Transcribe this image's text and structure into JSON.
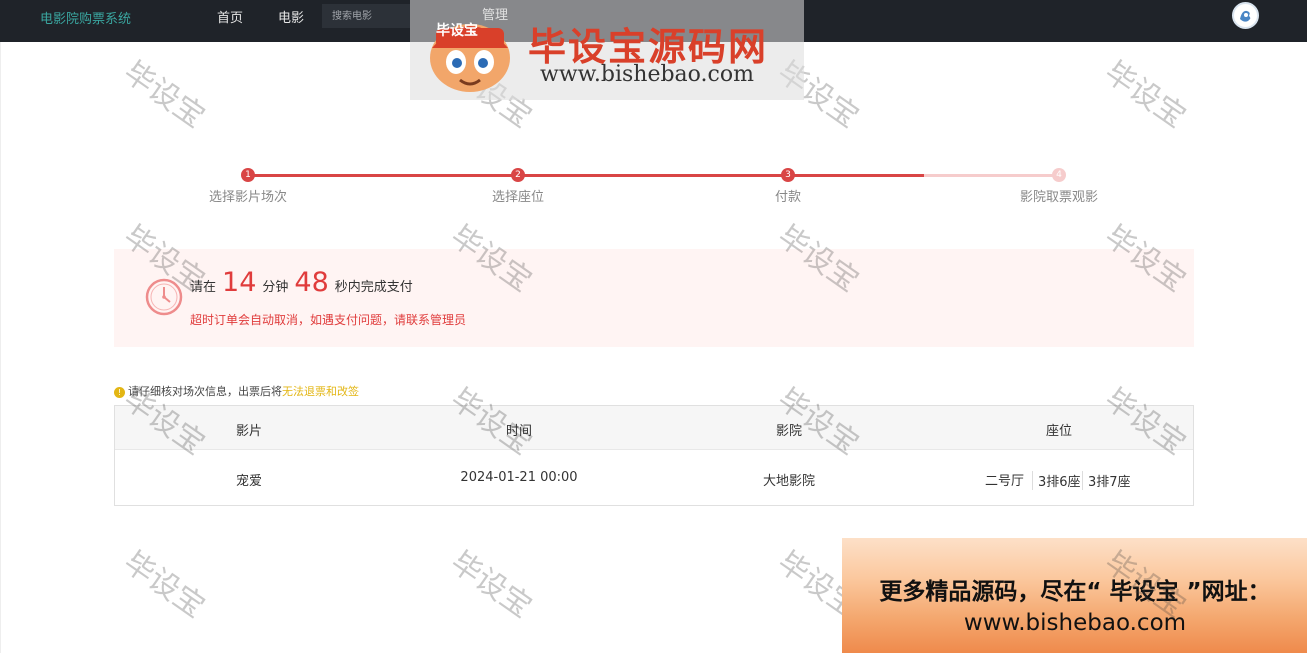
{
  "topbar": {
    "brand": "电影院购票系统",
    "nav": [
      "首页",
      "电影",
      "管理"
    ],
    "search_placeholder": "搜索电影"
  },
  "watermark": {
    "logo_text": "毕设宝",
    "title": "毕设宝源码网",
    "url": "www.bishebao.com",
    "stamp": "毕设宝"
  },
  "steps": [
    {
      "num": "1",
      "label": "选择影片场次"
    },
    {
      "num": "2",
      "label": "选择座位"
    },
    {
      "num": "3",
      "label": "付款"
    },
    {
      "num": "4",
      "label": "影院取票观影"
    }
  ],
  "timer": {
    "prefix": "请在",
    "minutes": "14",
    "min_unit": "分钟",
    "seconds": "48",
    "suffix": "秒内完成支付",
    "warning": "超时订单会自动取消，如遇支付问题，请联系管理员"
  },
  "notice": {
    "text": "请仔细核对场次信息，出票后将",
    "highlight": "无法退票和改签"
  },
  "table": {
    "headers": [
      "影片",
      "时间",
      "影院",
      "座位"
    ],
    "row": {
      "movie": "宠爱",
      "time": "2024-01-21 00:00",
      "cinema": "大地影院",
      "hall": "二号厅",
      "seats": [
        "3排6座",
        "3排7座"
      ]
    }
  },
  "ad": {
    "line1": "更多精品源码，尽在“ 毕设宝 ”网址：",
    "line2": "www.bishebao.com"
  },
  "colors": {
    "accent": "#e03c3c",
    "topbar": "#1f2329",
    "brand": "#3aa6a0",
    "notice_highlight": "#e3b614"
  }
}
